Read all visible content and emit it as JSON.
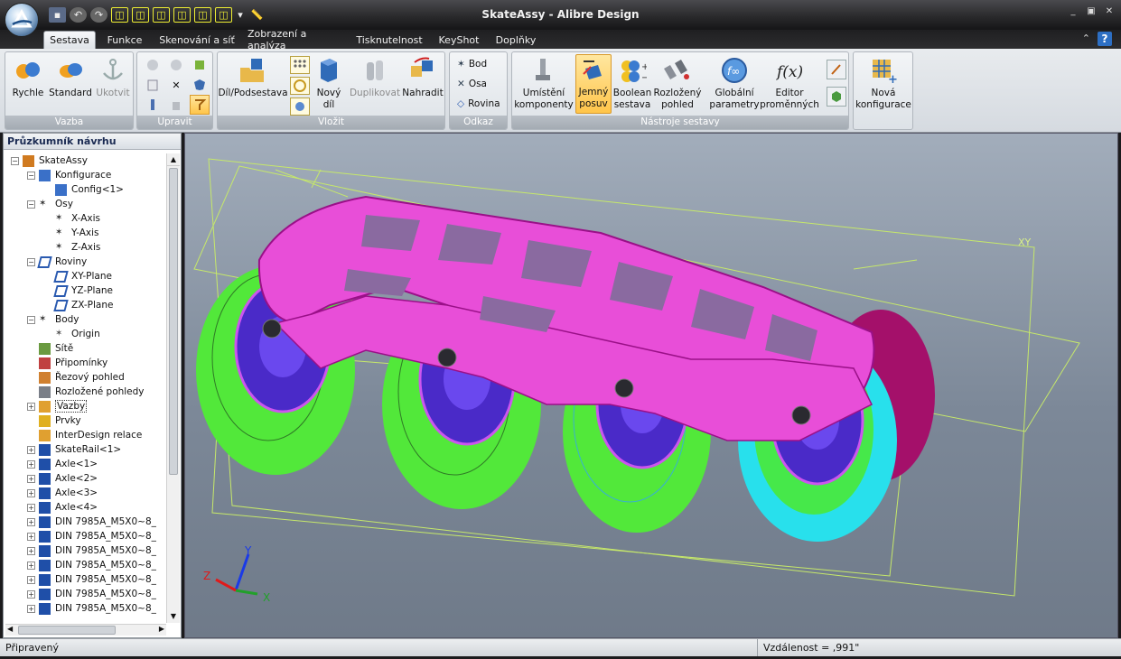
{
  "window": {
    "title": "SkateAssy - Alibre Design",
    "min": "_",
    "max": "▣",
    "close": "✕"
  },
  "tabs": [
    {
      "label": "Sestava"
    },
    {
      "label": "Funkce"
    },
    {
      "label": "Skenování a síť"
    },
    {
      "label": "Zobrazení a analýza"
    },
    {
      "label": "Tisknutelnost"
    },
    {
      "label": "KeyShot"
    },
    {
      "label": "Doplňky"
    }
  ],
  "ribbon": {
    "vazba": {
      "label": "Vazba",
      "rychle": "Rychle",
      "standard": "Standard",
      "ukotvit": "Ukotvit"
    },
    "upravit": {
      "label": "Upravit"
    },
    "vlozit": {
      "label": "Vložit",
      "dil_podsestava": "Díl/Podsestava",
      "novy_dil_1": "Nový",
      "novy_dil_2": "díl",
      "duplikovat": "Duplikovat",
      "nahradit": "Nahradit"
    },
    "odkaz": {
      "label": "Odkaz",
      "bod": "Bod",
      "osa": "Osa",
      "rovina": "Rovina"
    },
    "nastroje": {
      "label": "Nástroje sestavy",
      "umisteni_1": "Umístění",
      "umisteni_2": "komponenty",
      "jemny_1": "Jemný",
      "jemny_2": "posuv",
      "boolean_1": "Boolean",
      "boolean_2": "sestava",
      "rozlozeny_1": "Rozložený",
      "rozlozeny_2": "pohled",
      "globalni_1": "Globální",
      "globalni_2": "parametry",
      "editor_1": "Editor",
      "editor_2": "proměnných"
    },
    "konfig": {
      "nova_1": "Nová",
      "nova_2": "konfigurace"
    }
  },
  "explorer": {
    "title": "Průzkumník návrhu",
    "nodes": [
      {
        "label": "SkateAssy",
        "icon": "assembly-icon"
      },
      {
        "label": "Konfigurace",
        "icon": "configuration-icon"
      },
      {
        "label": "Config<1>",
        "icon": "config-icon"
      },
      {
        "label": "Osy",
        "icon": "axes-icon"
      },
      {
        "label": "X-Axis",
        "icon": "axis-icon"
      },
      {
        "label": "Y-Axis",
        "icon": "axis-icon"
      },
      {
        "label": "Z-Axis",
        "icon": "axis-icon"
      },
      {
        "label": "Roviny",
        "icon": "planes-icon"
      },
      {
        "label": "XY-Plane",
        "icon": "plane-icon"
      },
      {
        "label": "YZ-Plane",
        "icon": "plane-icon"
      },
      {
        "label": "ZX-Plane",
        "icon": "plane-icon"
      },
      {
        "label": "Body",
        "icon": "points-icon"
      },
      {
        "label": "Origin",
        "icon": "origin-icon"
      },
      {
        "label": "Sítě",
        "icon": "mesh-icon"
      },
      {
        "label": "Připomínky",
        "icon": "annotation-icon"
      },
      {
        "label": "Řezový pohled",
        "icon": "section-view-icon"
      },
      {
        "label": "Rozložené pohledy",
        "icon": "exploded-view-icon"
      },
      {
        "label": "Vazby",
        "icon": "constraints-icon"
      },
      {
        "label": "Prvky",
        "icon": "features-icon"
      },
      {
        "label": "InterDesign relace",
        "icon": "interdesign-icon"
      },
      {
        "label": "SkateRail<1>",
        "icon": "part-icon"
      },
      {
        "label": "Axle<1>",
        "icon": "part-icon"
      },
      {
        "label": "Axle<2>",
        "icon": "part-icon"
      },
      {
        "label": "Axle<3>",
        "icon": "part-icon"
      },
      {
        "label": "Axle<4>",
        "icon": "part-icon"
      },
      {
        "label": "DIN 7985A_M5X0~8_",
        "icon": "part-icon"
      },
      {
        "label": "DIN 7985A_M5X0~8_",
        "icon": "part-icon"
      },
      {
        "label": "DIN 7985A_M5X0~8_",
        "icon": "part-icon"
      },
      {
        "label": "DIN 7985A_M5X0~8_",
        "icon": "part-icon"
      },
      {
        "label": "DIN 7985A_M5X0~8_",
        "icon": "part-icon"
      },
      {
        "label": "DIN 7985A_M5X0~8_",
        "icon": "part-icon"
      },
      {
        "label": "DIN 7985A_M5X0~8_",
        "icon": "part-icon"
      }
    ]
  },
  "viewport": {
    "plane_label": "XY",
    "axis_x": "X",
    "axis_y": "Y",
    "axis_z": "Z"
  },
  "status": {
    "left": "Připravený",
    "right": "Vzdálenost = ,991\""
  }
}
